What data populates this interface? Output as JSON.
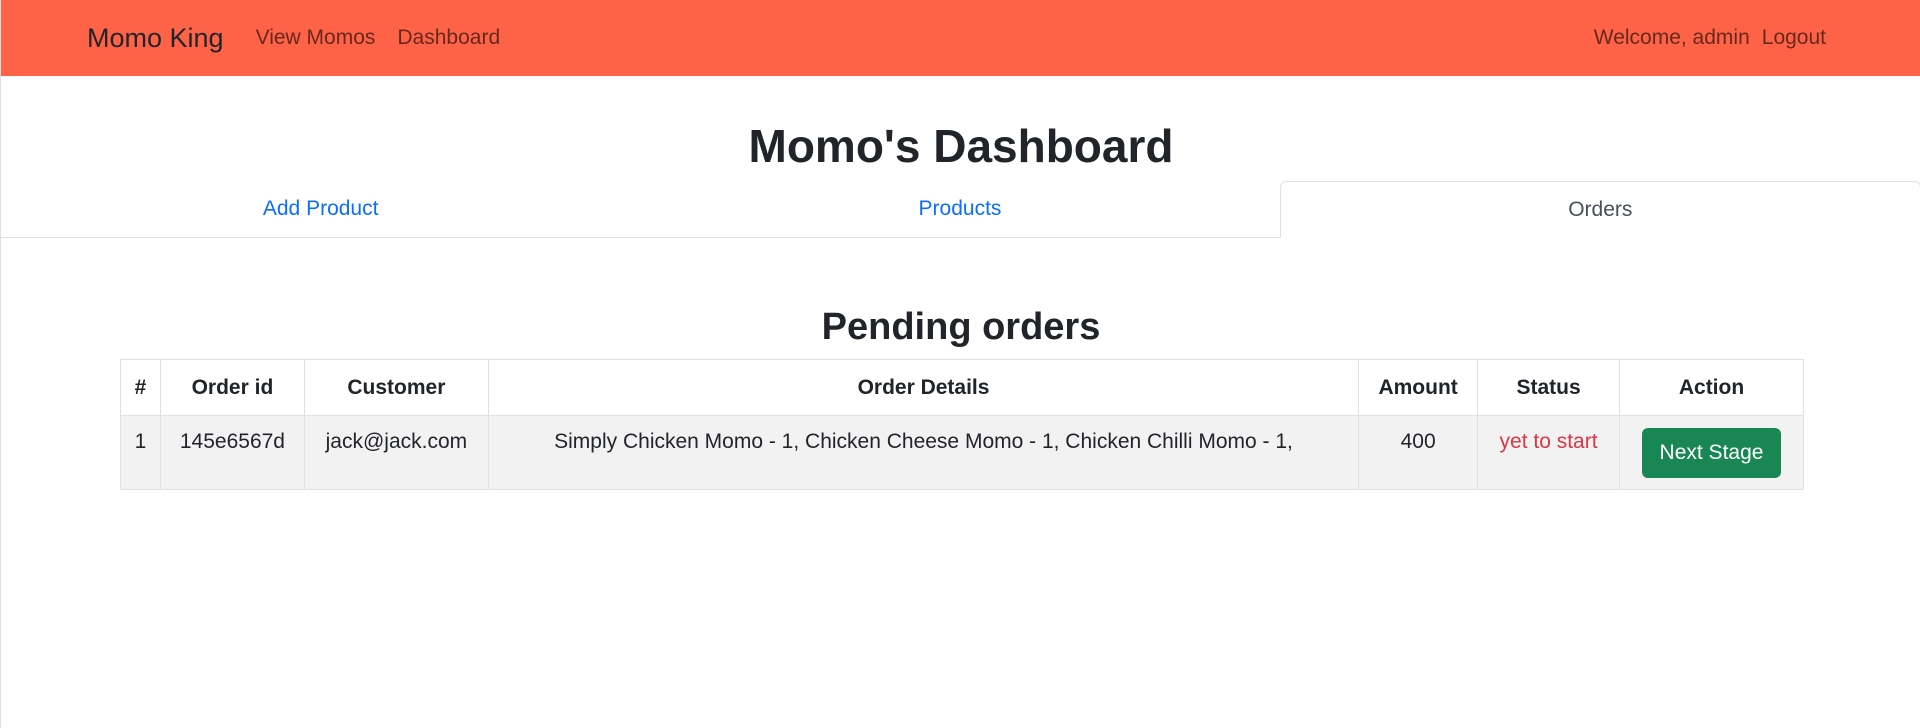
{
  "navbar": {
    "brand": "Momo King",
    "links": [
      "View Momos",
      "Dashboard"
    ],
    "welcome": "Welcome, admin",
    "logout": "Logout"
  },
  "page": {
    "title": "Momo's Dashboard"
  },
  "tabs": [
    "Add Product",
    "Products",
    "Orders"
  ],
  "orders": {
    "title": "Pending orders",
    "columns": [
      "#",
      "Order id",
      "Customer",
      "Order Details",
      "Amount",
      "Status",
      "Action"
    ],
    "rows": [
      {
        "index": "1",
        "order_id": "145e6567d",
        "customer": "jack@jack.com",
        "details": "Simply Chicken Momo - 1, Chicken Cheese Momo - 1, Chicken Chilli Momo - 1,",
        "amount": "400",
        "status": "yet to start",
        "action": "Next Stage"
      }
    ]
  },
  "colors": {
    "navbar_bg": "#ff6347",
    "link": "#0d6efd",
    "status_pending": "#dc3545",
    "action_button": "#198754"
  }
}
